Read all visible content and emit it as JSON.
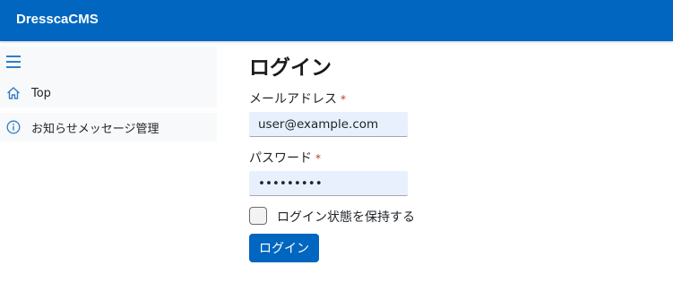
{
  "header": {
    "brand": "DresscaCMS"
  },
  "sidebar": {
    "items": [
      {
        "label": "Top",
        "icon": "home-icon"
      },
      {
        "label": "お知らせメッセージ管理",
        "icon": "info-icon"
      }
    ]
  },
  "login": {
    "title": "ログイン",
    "email_label": "メールアドレス",
    "required_mark": "*",
    "email_value": "user@example.com",
    "password_label": "パスワード",
    "password_value": "password1",
    "remember_label": "ログイン状態を保持する",
    "remember_checked": false,
    "submit_label": "ログイン"
  },
  "colors": {
    "brand": "#0066c0",
    "input_bg": "#e8f0fe",
    "required": "#c0392b"
  }
}
